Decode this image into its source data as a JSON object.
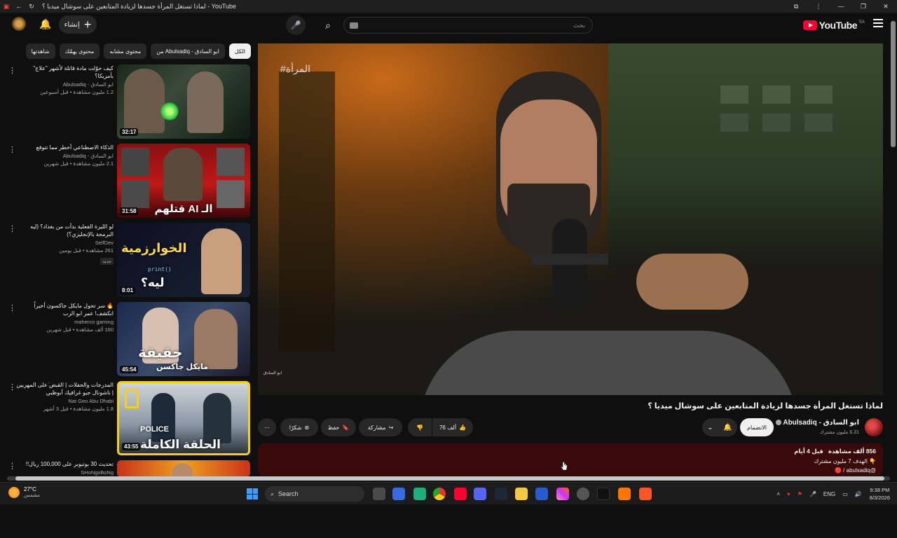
{
  "window": {
    "title": "لماذا تستغل المرأة جسدها لزيادة المتابعين على سوشال ميديا ؟ - YouTube"
  },
  "header": {
    "logo_text": "YouTube",
    "logo_country": "SA",
    "search_placeholder": "بحث",
    "create_label": "إنشاء"
  },
  "chips": [
    "الكل",
    "من Abulsadiq - ابو السادق",
    "محتوى مشابه",
    "محتوى يهمّك",
    "شاهدتها"
  ],
  "recommendations": [
    {
      "title": "كيف حوّلت مادة قاتلة لأشهر \"علاج\" بأمريكا؟",
      "channel": "ابو السادق - Abulsadiq",
      "meta": "1.2 مليون مشاهدة • قبل أسبوعين",
      "duration": "32:17",
      "thumb_text": ""
    },
    {
      "title": "الذكاء الاصطناعي أخطر مما تتوقع",
      "channel": "ابو السادق - Abulsadiq",
      "meta": "2.1 مليون مشاهدة • قبل شهرين",
      "duration": "31:58",
      "thumb_text": "الـ AI قتلهم"
    },
    {
      "title": "لو الليرة الفعلية بدأت من بغداد؟ (ليه البرمجة بالإنجليزي؟)",
      "channel": "SelfDev",
      "meta": "261 مشاهدة • قبل يومين",
      "badge": "جديد",
      "duration": "8:01",
      "thumb_text": "الخوارزمية",
      "thumb_sub": "ليه؟",
      "thumb_code": "print()"
    },
    {
      "title": "🔥 سر تحول مايكل جاكسون أخيراً انكشف! عمر ابو الرب",
      "channel": "maherco gaming",
      "meta": "160 ألف مشاهدة • قبل شهرين",
      "duration": "45:54",
      "thumb_text": "حقيقة",
      "thumb_sub": "مايكل جاكسن"
    },
    {
      "title": "المدرجات والحفلات | القبض على المهربين | ناشونال جيو غرافيك أبوظبي",
      "channel": "Nat Geo Abu Dhabi",
      "meta": "1.8 مليون مشاهدة • قبل 3 أشهر",
      "duration": "43:55",
      "thumb_text": "الحلقة الكاملة",
      "thumb_police": "POLICE"
    },
    {
      "title": "تحديث 30 بوتيوبر على 100,000 ريال!!",
      "channel": "SHoNgxBoNg",
      "meta": "",
      "duration": "",
      "thumb_text": ""
    }
  ],
  "player": {
    "hashtag": "#المرأة",
    "watermark": "ابو السادق"
  },
  "video": {
    "title": "لماذا تستغل المرأة جسدها لزيادة المتابعين على سوشال ميديا ؟",
    "channel_name": "ابو السادق - Abulsadiq",
    "subscribers": "6.31 مليون مشترك",
    "subscribe_label": "الانضمام",
    "likes": "76 ألف",
    "share_label": "مشاركة",
    "save_label": "حفظ",
    "thanks_label": "شكرًا"
  },
  "description": {
    "views": "856 ألف مشاهدة",
    "date": "قبل 4 أيام",
    "line2": "👇 الهدف 7 مليون مشترك",
    "line3": "@abulsadiq / 🔴"
  },
  "taskbar": {
    "temp": "27°C",
    "weather_desc": "مشمس",
    "search_label": "Search",
    "lang": "ENG",
    "time": "9:38 PM",
    "date": "8/3/2026"
  },
  "colors": {
    "yt_red": "#ff0033",
    "description_bg": "#3a0a0a"
  }
}
